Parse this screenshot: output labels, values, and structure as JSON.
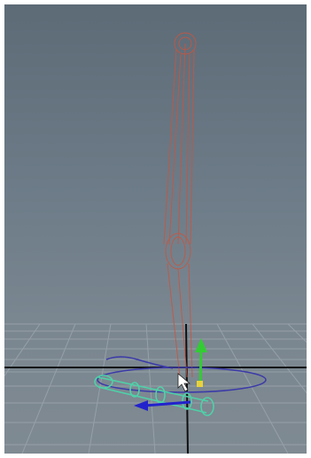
{
  "viewport": {
    "kind": "3d-perspective-viewport",
    "background_top": "#5d6b77",
    "background_bottom": "#7f8a92",
    "grid_color": "#9aa5ad",
    "grid_axis_color": "#111111",
    "rig_color": "#c8553f",
    "selection_color": "#4fd1a8",
    "control_color": "#3b3aa8",
    "manipulator_y_color": "#33cc33",
    "manipulator_z_color": "#2222cc"
  },
  "objects": {
    "rig": "leg-joint-chain",
    "foot_control": "foot-control-curve",
    "ground_circle": "ground-control-circle",
    "manipulator": "move-manipulator",
    "cursor": "mouse-cursor"
  }
}
